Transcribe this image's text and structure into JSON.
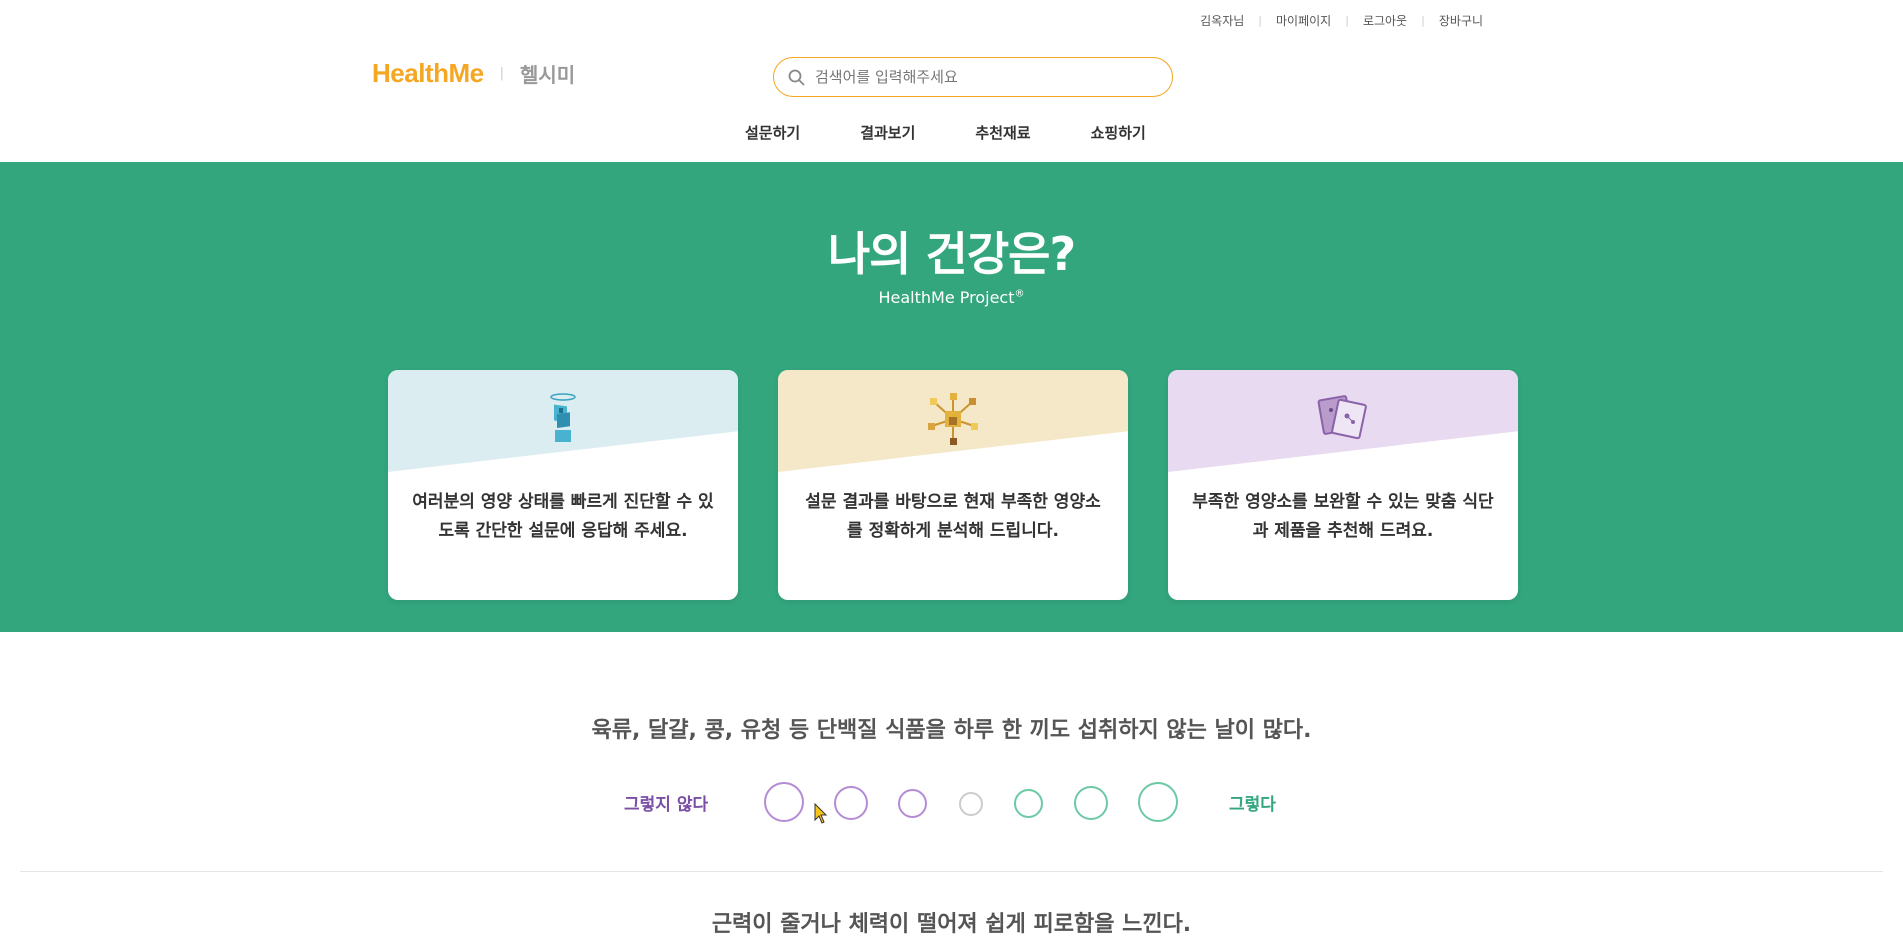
{
  "util_nav": {
    "user": "김옥자님",
    "mypage": "마이페이지",
    "logout": "로그아웃",
    "cart": "장바구니"
  },
  "logo": {
    "en": "HealthMe",
    "ko": "헬시미"
  },
  "search": {
    "placeholder": "검색어를 입력해주세요"
  },
  "nav": [
    "설문하기",
    "결과보기",
    "추천재료",
    "쇼핑하기"
  ],
  "hero": {
    "title": "나의 건강은?",
    "subtitle": "HealthMe Project",
    "subtitle_mark": "®",
    "cards": [
      {
        "text": "여러분의 영양 상태를 빠르게 진단할 수 있도록 간단한 설문에 응답해 주세요.",
        "band_color": "#dcedf2",
        "icon": "blue-figure-icon"
      },
      {
        "text": "설문 결과를 바탕으로 현재 부족한 영양소를 정확하게 분석해 드립니다.",
        "band_color": "#f5e8c8",
        "icon": "molecule-icon"
      },
      {
        "text": "부족한 영양소를 보완할 수 있는 맞춤 식단과 제품을 추천해 드려요.",
        "band_color": "#e8daf0",
        "icon": "cards-icon"
      }
    ]
  },
  "question": {
    "text": "육류, 달걀, 콩, 유청 등 단백질 식품을 하루 한 끼도 섭취하지 않는 날이 많다.",
    "label_no": "그렇지 않다",
    "label_yes": "그렇다",
    "colors": {
      "disagree": "#b58bd6",
      "neutral": "#cccccc",
      "agree": "#6cc9a4"
    }
  },
  "next_question": "근력이 줄거나 체력이 떨어져 쉽게 피로함을 느낀다."
}
